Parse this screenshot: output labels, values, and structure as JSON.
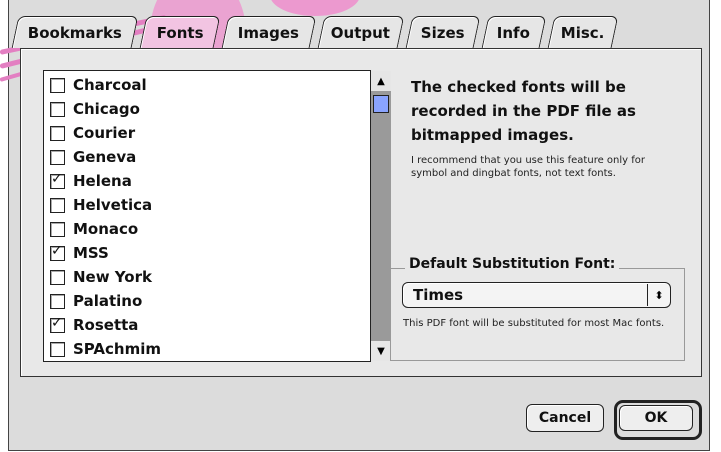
{
  "tabs": [
    "Bookmarks",
    "Fonts",
    "Images",
    "Output",
    "Sizes",
    "Info",
    "Misc."
  ],
  "active_tab": "Fonts",
  "font_list": [
    {
      "label": "Charcoal",
      "checked": false
    },
    {
      "label": "Chicago",
      "checked": false
    },
    {
      "label": "Courier",
      "checked": false
    },
    {
      "label": "Geneva",
      "checked": false
    },
    {
      "label": "Helena",
      "checked": true
    },
    {
      "label": "Helvetica",
      "checked": false
    },
    {
      "label": "Monaco",
      "checked": false
    },
    {
      "label": "MSS",
      "checked": true
    },
    {
      "label": "New York",
      "checked": false
    },
    {
      "label": "Palatino",
      "checked": false
    },
    {
      "label": "Rosetta",
      "checked": true
    },
    {
      "label": "SPAchmim",
      "checked": false
    }
  ],
  "description": {
    "heading": "The checked fonts will be recorded in the PDF file as bitmapped images.",
    "body": "I recommend that you use this feature only for symbol and dingbat fonts, not text fonts."
  },
  "substitution": {
    "group_title": "Default Substitution Font:",
    "selected": "Times",
    "note": "This PDF font will be substituted for most Mac fonts."
  },
  "buttons": {
    "cancel": "Cancel",
    "ok": "OK"
  },
  "colors": {
    "highlight": "#ec99cf",
    "scroll_thumb": "#8aa4ff"
  }
}
